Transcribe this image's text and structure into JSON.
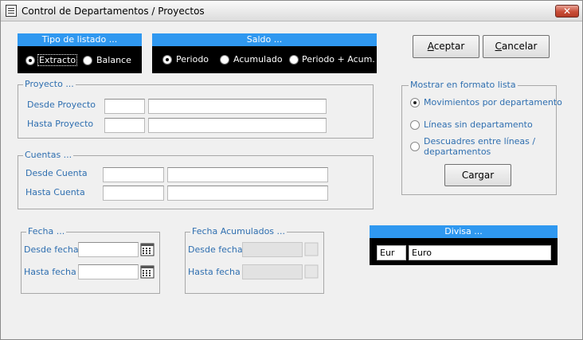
{
  "window": {
    "title": "Control de Departamentos / Proyectos",
    "close_glyph": "✕"
  },
  "tipo_listado": {
    "header": "Tipo de listado ...",
    "options": [
      {
        "label": "Extracto",
        "selected": true
      },
      {
        "label": "Balance",
        "selected": false
      }
    ]
  },
  "saldo": {
    "header": "Saldo ...",
    "options": [
      {
        "label": "Periodo",
        "selected": true
      },
      {
        "label": "Acumulado",
        "selected": false
      },
      {
        "label": "Periodo + Acum.",
        "selected": false
      }
    ]
  },
  "buttons": {
    "aceptar_pre": "A",
    "aceptar_rest": "ceptar",
    "cancelar_pre": "C",
    "cancelar_rest": "ancelar",
    "cargar": "Cargar"
  },
  "proyecto": {
    "legend": "Proyecto ...",
    "desde_label": "Desde Proyecto",
    "hasta_label": "Hasta Proyecto"
  },
  "cuentas": {
    "legend": "Cuentas ...",
    "desde_label": "Desde Cuenta",
    "hasta_label": "Hasta Cuenta"
  },
  "fecha": {
    "legend": "Fecha ...",
    "desde_label": "Desde fecha",
    "hasta_label": "Hasta fecha"
  },
  "fecha_acumulados": {
    "legend": "Fecha Acumulados ...",
    "desde_label": "Desde fecha",
    "hasta_label": "Hasta fecha"
  },
  "mostrar": {
    "legend": "Mostrar en formato lista",
    "options": [
      {
        "label": "Movimientos por departamento",
        "selected": true
      },
      {
        "label": "Líneas sin departamento",
        "selected": false
      },
      {
        "label_line1": "Descuadres entre líneas /",
        "label_line2": "departamentos",
        "selected": false
      }
    ]
  },
  "divisa": {
    "header": "Divisa ...",
    "code": "Eur",
    "name": "Euro"
  },
  "colors": {
    "header_blue": "#2f98f0",
    "label_blue": "#2f6fb0"
  },
  "icons": {
    "app": "document-list-icon",
    "calendar": "calendar-icon"
  }
}
